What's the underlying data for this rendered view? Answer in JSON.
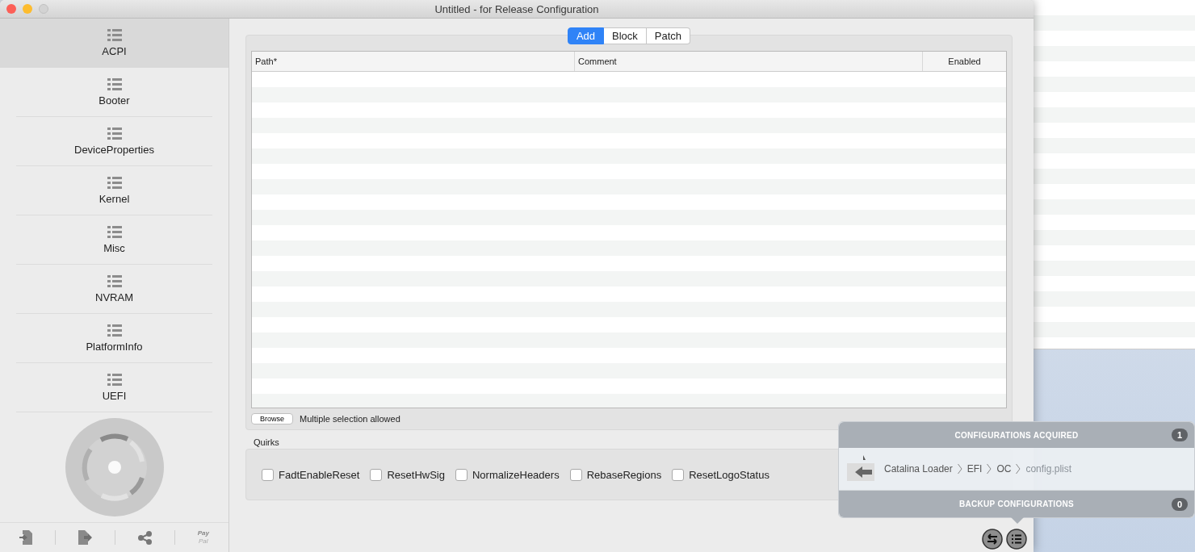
{
  "window": {
    "title": "Untitled - for Release Configuration"
  },
  "sidebar": {
    "items": [
      {
        "label": "ACPI",
        "selected": true
      },
      {
        "label": "Booter",
        "selected": false
      },
      {
        "label": "DeviceProperties",
        "selected": false
      },
      {
        "label": "Kernel",
        "selected": false
      },
      {
        "label": "Misc",
        "selected": false
      },
      {
        "label": "NVRAM",
        "selected": false
      },
      {
        "label": "PlatformInfo",
        "selected": false
      },
      {
        "label": "UEFI",
        "selected": false
      }
    ],
    "paypal": {
      "line_1": "Pay",
      "line_2": "Pal"
    }
  },
  "tabs": [
    {
      "label": "Add",
      "selected": true
    },
    {
      "label": "Block",
      "selected": false
    },
    {
      "label": "Patch",
      "selected": false
    }
  ],
  "table": {
    "columns": [
      "Path*",
      "Comment",
      "Enabled"
    ]
  },
  "browse_button": "Browse",
  "browse_note": "Multiple selection allowed",
  "quirks": {
    "title": "Quirks",
    "items": [
      {
        "label": "FadtEnableReset",
        "checked": false
      },
      {
        "label": "ResetHwSig",
        "checked": false
      },
      {
        "label": "NormalizeHeaders",
        "checked": false
      },
      {
        "label": "RebaseRegions",
        "checked": false
      },
      {
        "label": "ResetLogoStatus",
        "checked": false
      }
    ]
  },
  "popover": {
    "acquired_title": "CONFIGURATIONS ACQUIRED",
    "acquired_count": "1",
    "path": [
      "Catalina Loader",
      "EFI",
      "OC",
      "config.plist"
    ],
    "backup_title": "BACKUP CONFIGURATIONS",
    "backup_count": "0"
  }
}
